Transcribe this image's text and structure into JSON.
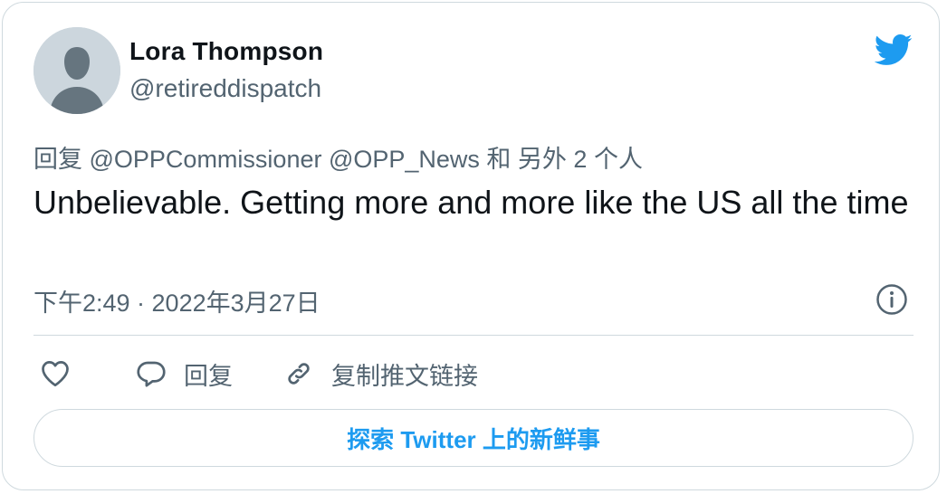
{
  "tweet": {
    "author_name": "Lora Thompson",
    "author_handle": "@retireddispatch",
    "reply_to": "回复 @OPPCommissioner @OPP_News 和 另外 2 个人",
    "text": "Unbelievable. Getting more and more like the US all the time",
    "timestamp": "下午2:49 · 2022年3月27日"
  },
  "actions": {
    "like_icon": "heart-icon",
    "reply_icon": "speech-bubble-icon",
    "reply_label": "回复",
    "copy_icon": "link-icon",
    "copy_label": "复制推文链接"
  },
  "explore": {
    "label": "探索 Twitter 上的新鲜事"
  },
  "colors": {
    "brand": "#1d9bf0",
    "secondary_text": "#536471",
    "border": "#cfd9de",
    "avatar_bg": "#ccd6dd"
  }
}
